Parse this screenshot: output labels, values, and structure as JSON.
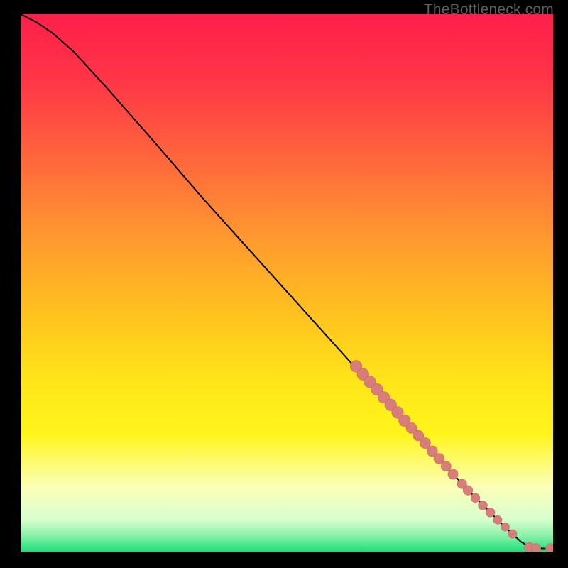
{
  "watermark": "TheBottleneck.com",
  "colors": {
    "background": "#000000",
    "gradient_stops": [
      {
        "offset": 0.0,
        "color": "#ff1f4a"
      },
      {
        "offset": 0.12,
        "color": "#ff3547"
      },
      {
        "offset": 0.28,
        "color": "#ff6a3b"
      },
      {
        "offset": 0.42,
        "color": "#ff9a2f"
      },
      {
        "offset": 0.56,
        "color": "#ffc21e"
      },
      {
        "offset": 0.68,
        "color": "#ffe41a"
      },
      {
        "offset": 0.78,
        "color": "#fff51a"
      },
      {
        "offset": 0.88,
        "color": "#fbffb7"
      },
      {
        "offset": 0.94,
        "color": "#d8ffcf"
      },
      {
        "offset": 0.97,
        "color": "#8af0a8"
      },
      {
        "offset": 1.0,
        "color": "#18e07a"
      }
    ],
    "curve": "#000000",
    "marker_fill": "#d87d7a",
    "marker_stroke": "#c26a67"
  },
  "chart_data": {
    "type": "line",
    "title": "",
    "xlabel": "",
    "ylabel": "",
    "xlim": [
      0,
      100
    ],
    "ylim": [
      0,
      100
    ],
    "curve": [
      {
        "x": 0,
        "y": 100
      },
      {
        "x": 3,
        "y": 98.5
      },
      {
        "x": 6,
        "y": 96.5
      },
      {
        "x": 10,
        "y": 93.0
      },
      {
        "x": 16,
        "y": 86.5
      },
      {
        "x": 24,
        "y": 77.5
      },
      {
        "x": 34,
        "y": 66.0
      },
      {
        "x": 44,
        "y": 55.0
      },
      {
        "x": 54,
        "y": 44.0
      },
      {
        "x": 64,
        "y": 33.0
      },
      {
        "x": 74,
        "y": 22.0
      },
      {
        "x": 84,
        "y": 11.5
      },
      {
        "x": 90,
        "y": 5.5
      },
      {
        "x": 94,
        "y": 1.8
      },
      {
        "x": 96,
        "y": 0.7
      },
      {
        "x": 98,
        "y": 0.6
      },
      {
        "x": 100,
        "y": 0.6
      }
    ],
    "markers": [
      {
        "x": 63.0,
        "y": 34.5,
        "r": 1.1
      },
      {
        "x": 64.3,
        "y": 33.0,
        "r": 1.1
      },
      {
        "x": 65.6,
        "y": 31.6,
        "r": 1.1
      },
      {
        "x": 66.9,
        "y": 30.2,
        "r": 1.1
      },
      {
        "x": 68.2,
        "y": 28.7,
        "r": 1.1
      },
      {
        "x": 69.5,
        "y": 27.3,
        "r": 1.1
      },
      {
        "x": 70.8,
        "y": 25.9,
        "r": 1.1
      },
      {
        "x": 72.1,
        "y": 24.4,
        "r": 1.1
      },
      {
        "x": 73.4,
        "y": 23.0,
        "r": 1.0
      },
      {
        "x": 74.7,
        "y": 21.6,
        "r": 1.0
      },
      {
        "x": 76.0,
        "y": 20.2,
        "r": 1.0
      },
      {
        "x": 77.3,
        "y": 18.7,
        "r": 1.0
      },
      {
        "x": 78.6,
        "y": 17.3,
        "r": 1.0
      },
      {
        "x": 79.9,
        "y": 15.9,
        "r": 0.95
      },
      {
        "x": 81.2,
        "y": 14.4,
        "r": 0.95
      },
      {
        "x": 82.9,
        "y": 12.6,
        "r": 0.9
      },
      {
        "x": 84.0,
        "y": 11.4,
        "r": 0.9
      },
      {
        "x": 85.4,
        "y": 10.0,
        "r": 0.85
      },
      {
        "x": 86.8,
        "y": 8.6,
        "r": 0.85
      },
      {
        "x": 88.2,
        "y": 7.3,
        "r": 0.85
      },
      {
        "x": 89.6,
        "y": 5.9,
        "r": 0.8
      },
      {
        "x": 91.0,
        "y": 4.6,
        "r": 0.8
      },
      {
        "x": 92.4,
        "y": 3.3,
        "r": 0.8
      },
      {
        "x": 95.5,
        "y": 0.8,
        "r": 0.9
      },
      {
        "x": 96.8,
        "y": 0.6,
        "r": 0.9
      },
      {
        "x": 99.5,
        "y": 0.6,
        "r": 0.9
      },
      {
        "x": 100.5,
        "y": 0.6,
        "r": 0.9
      }
    ]
  }
}
